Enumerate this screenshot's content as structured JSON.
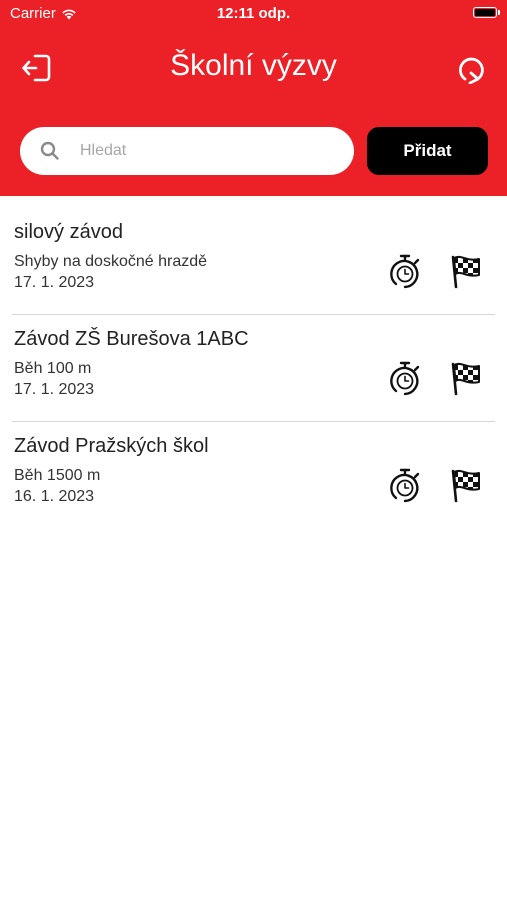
{
  "status_bar": {
    "carrier": "Carrier",
    "time": "12:11 odp."
  },
  "header": {
    "title": "Školní výzvy",
    "logout_icon": "logout-icon",
    "refresh_icon": "refresh-icon",
    "background_color": "#ec2027"
  },
  "search": {
    "placeholder": "Hledat",
    "value": ""
  },
  "add_button": {
    "label": "Přidat"
  },
  "challenges": [
    {
      "title": "silový závod",
      "discipline": "Shyby na doskočné hrazdě",
      "date": "17. 1. 2023"
    },
    {
      "title": "Závod ZŠ Burešova 1ABC",
      "discipline": "Běh 100 m",
      "date": "17. 1. 2023"
    },
    {
      "title": "Závod Pražských škol",
      "discipline": "Běh 1500 m",
      "date": "16. 1. 2023"
    }
  ],
  "item_icons": {
    "timer": "stopwatch-icon",
    "results": "checkered-flag-icon"
  }
}
